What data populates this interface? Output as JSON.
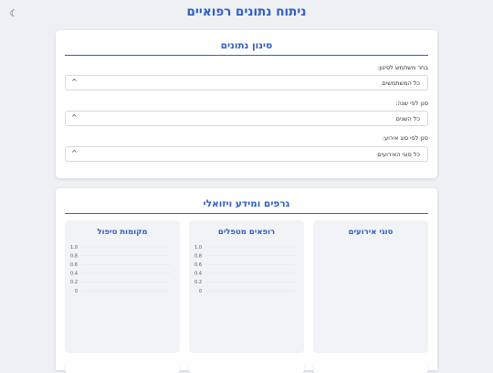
{
  "header": {
    "title": "ניתוח נתונים רפואיים",
    "theme_icon": "moon-icon"
  },
  "filters": {
    "title": "סינון נתונים",
    "user": {
      "label": "בחר משתמש לסינון:",
      "value": "כל המשתמשים"
    },
    "year": {
      "label": "סנן לפי שנה:",
      "value": "כל השנים"
    },
    "event_type": {
      "label": "סנן לפי סוג אירוע:",
      "value": "כל סוגי האירועים"
    }
  },
  "charts_section": {
    "title": "גרפים ומידע ויזואלי",
    "charts": [
      {
        "title": "סוגי אירועים"
      },
      {
        "title": "רופאים מטפלים",
        "yticks": [
          "1.0",
          "0.8",
          "0.6",
          "0.4",
          "0.2",
          "0"
        ]
      },
      {
        "title": "מקומות טיפול",
        "yticks": [
          "1.0",
          "0.8",
          "0.6",
          "0.4",
          "0.2",
          "0"
        ]
      }
    ]
  },
  "chart_data": [
    {
      "type": "bar",
      "title": "רופאים מטפלים",
      "categories": [],
      "values": [],
      "ylim": [
        0,
        1
      ],
      "grid": true
    },
    {
      "type": "bar",
      "title": "מקומות טיפול",
      "categories": [],
      "values": [],
      "ylim": [
        0,
        1
      ],
      "grid": true
    }
  ],
  "colors": {
    "accent": "#2f5ec4",
    "background": "#eef0f4",
    "panel": "#f2f3f6"
  }
}
